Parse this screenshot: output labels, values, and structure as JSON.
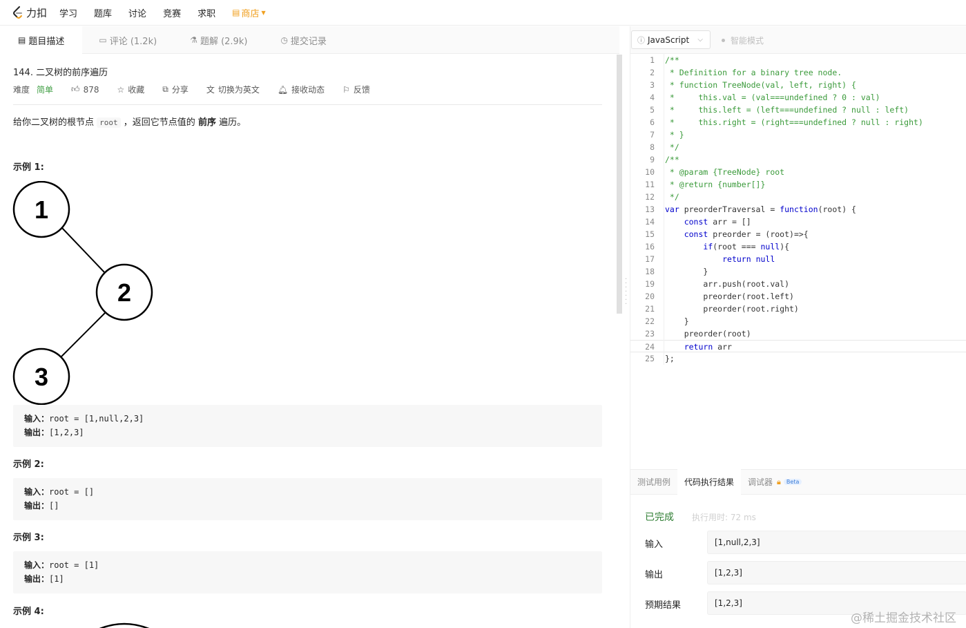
{
  "nav": {
    "logo_text": "力扣",
    "items": [
      "学习",
      "题库",
      "讨论",
      "竞赛",
      "求职"
    ],
    "store": "商店"
  },
  "left_tabs": [
    {
      "label": "题目描述",
      "icon": "description-icon"
    },
    {
      "label": "评论 (1.2k)",
      "icon": "comment-icon"
    },
    {
      "label": "题解 (2.9k)",
      "icon": "flask-icon"
    },
    {
      "label": "提交记录",
      "icon": "history-icon"
    }
  ],
  "problem": {
    "title": "144. 二叉树的前序遍历",
    "difficulty_label": "难度",
    "difficulty": "简单",
    "likes": "878",
    "favorite": "收藏",
    "share": "分享",
    "switch_lang": "切换为英文",
    "subscribe": "接收动态",
    "feedback": "反馈",
    "desc_prefix": "给你二叉树的根节点",
    "desc_code": "root",
    "desc_mid": "，返回它节点值的",
    "desc_bold": "前序",
    "desc_suffix": "遍历。"
  },
  "examples": [
    {
      "title": "示例 1:",
      "input_label": "输入：",
      "input": "root = [1,null,2,3]",
      "output_label": "输出：",
      "output": "[1,2,3]"
    },
    {
      "title": "示例 2:",
      "input_label": "输入：",
      "input": "root = []",
      "output_label": "输出：",
      "output": "[]"
    },
    {
      "title": "示例 3:",
      "input_label": "输入：",
      "input": "root = [1]",
      "output_label": "输出：",
      "output": "[1]"
    },
    {
      "title": "示例 4:"
    }
  ],
  "tree_nodes": [
    "1",
    "2",
    "3"
  ],
  "editor": {
    "language": "JavaScript",
    "smart_mode": "智能模式",
    "lines": [
      "/**",
      " * Definition for a binary tree node.",
      " * function TreeNode(val, left, right) {",
      " *     this.val = (val===undefined ? 0 : val)",
      " *     this.left = (left===undefined ? null : left)",
      " *     this.right = (right===undefined ? null : right)",
      " * }",
      " */",
      "/**",
      " * @param {TreeNode} root",
      " * @return {number[]}",
      " */",
      "var preorderTraversal = function(root) {",
      "    const arr = []",
      "    const preorder = (root)=>{",
      "        if(root === null){",
      "            return null",
      "        }",
      "        arr.push(root.val)",
      "        preorder(root.left)",
      "        preorder(root.right)",
      "    }",
      "    preorder(root)",
      "    return arr",
      "};"
    ]
  },
  "console": {
    "tabs": [
      "测试用例",
      "代码执行结果",
      "调试器"
    ],
    "beta": "Beta",
    "status": "已完成",
    "exec_time": "执行用时: 72 ms",
    "input_label": "输入",
    "input_value": "[1,null,2,3]",
    "output_label": "输出",
    "output_value": "[1,2,3]",
    "expected_label": "预期结果",
    "expected_value": "[1,2,3]"
  },
  "watermark": "@稀土掘金技术社区",
  "colors": {
    "accent_green": "#43a047",
    "store_orange": "#f0a020",
    "comment_green": "#3a9a3a",
    "keyword_blue": "#0000cc"
  }
}
